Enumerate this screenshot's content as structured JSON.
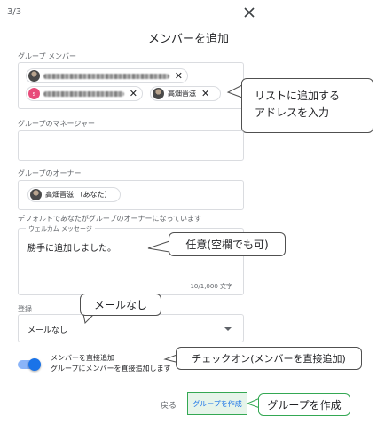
{
  "dialog": {
    "step": "3/3",
    "title": "メンバーを追加"
  },
  "members_field": {
    "label": "グループ メンバー",
    "chips": [
      {
        "name": "(redacted email)",
        "redacted": true,
        "avatar": "photo"
      },
      {
        "name": "(redacted email)",
        "redacted": true,
        "avatar": "pink-initial",
        "initial": "s"
      },
      {
        "name": "高畑晋滋",
        "redacted": false,
        "avatar": "photo"
      }
    ],
    "remove_icon": "close-icon"
  },
  "managers_field": {
    "label": "グループのマネージャー"
  },
  "owners_field": {
    "label": "グループのオーナー",
    "chip": "高畑晋滋 （あなた）",
    "hint": "デフォルトであなたがグループのオーナーになっています"
  },
  "welcome_field": {
    "label": "ウェルカム メッセージ",
    "value": "勝手に追加しました。",
    "counter": "10/1,000 文字"
  },
  "subscription_field": {
    "label": "登録",
    "selected": "メールなし"
  },
  "direct_add": {
    "title": "メンバーを直接追加",
    "subtitle": "グループにメンバーを直接追加します",
    "enabled": true
  },
  "buttons": {
    "back": "戻る",
    "create": "グループを作成"
  },
  "annotations": {
    "members_line1": "リストに追加する",
    "members_line2": "アドレスを入力",
    "welcome": "任意(空欄でも可)",
    "subscription": "メールなし",
    "direct_add": "チェックオン(メンバーを直接追加)",
    "create": "グループを作成"
  },
  "colors": {
    "accent": "#1a73e8",
    "annotation_border": "#505050",
    "create_highlight_border": "#34a853",
    "create_highlight_fill": "#e6f4ea"
  }
}
